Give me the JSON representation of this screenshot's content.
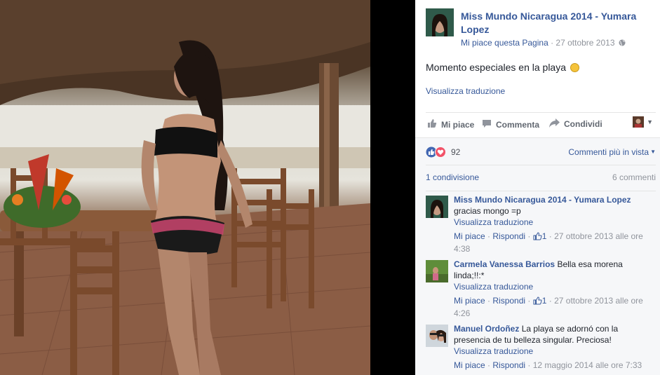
{
  "post": {
    "page_name": "Miss Mundo Nicaragua 2014 - Yumara Lopez",
    "like_page": "Mi piace questa Pagina",
    "separator": " · ",
    "date": "27 ottobre 2013",
    "visibility_icon": "globe-icon",
    "text": "Momento especiales en la playa",
    "translate": "Visualizza traduzione"
  },
  "actions": {
    "like": "Mi piace",
    "comment": "Commenta",
    "share": "Condividi"
  },
  "reactions": {
    "count": "92",
    "sort_label": "Commenti più in vista"
  },
  "shares": {
    "count_label": "1 condivisione",
    "comments_label": "6 commenti"
  },
  "comments": [
    {
      "author": "Miss Mundo Nicaragua 2014 - Yumara Lopez",
      "text": "gracias mongo =p",
      "translate": "Visualizza traduzione",
      "like": "Mi piace",
      "reply": "Rispondi",
      "likes": "1",
      "date": "27 ottobre 2013 alle ore 4:38"
    },
    {
      "author": "Carmela Vanessa Barrios",
      "text": "Bella esa morena linda;!!:*",
      "translate": "Visualizza traduzione",
      "like": "Mi piace",
      "reply": "Rispondi",
      "likes": "1",
      "date": "27 ottobre 2013 alle ore 4:26"
    },
    {
      "author": "Manuel Ordoñez",
      "text": "La playa se adornó con la presencia de tu belleza singular. Preciosa!",
      "like": "Mi piace",
      "reply": "Rispondi",
      "translate": "Visualizza traduzione",
      "date": "12 maggio 2014 alle ore 7:33"
    }
  ],
  "colors": {
    "link": "#365899",
    "muted": "#90949c",
    "like_blue": "#4267b2",
    "love_red": "#f25268"
  }
}
